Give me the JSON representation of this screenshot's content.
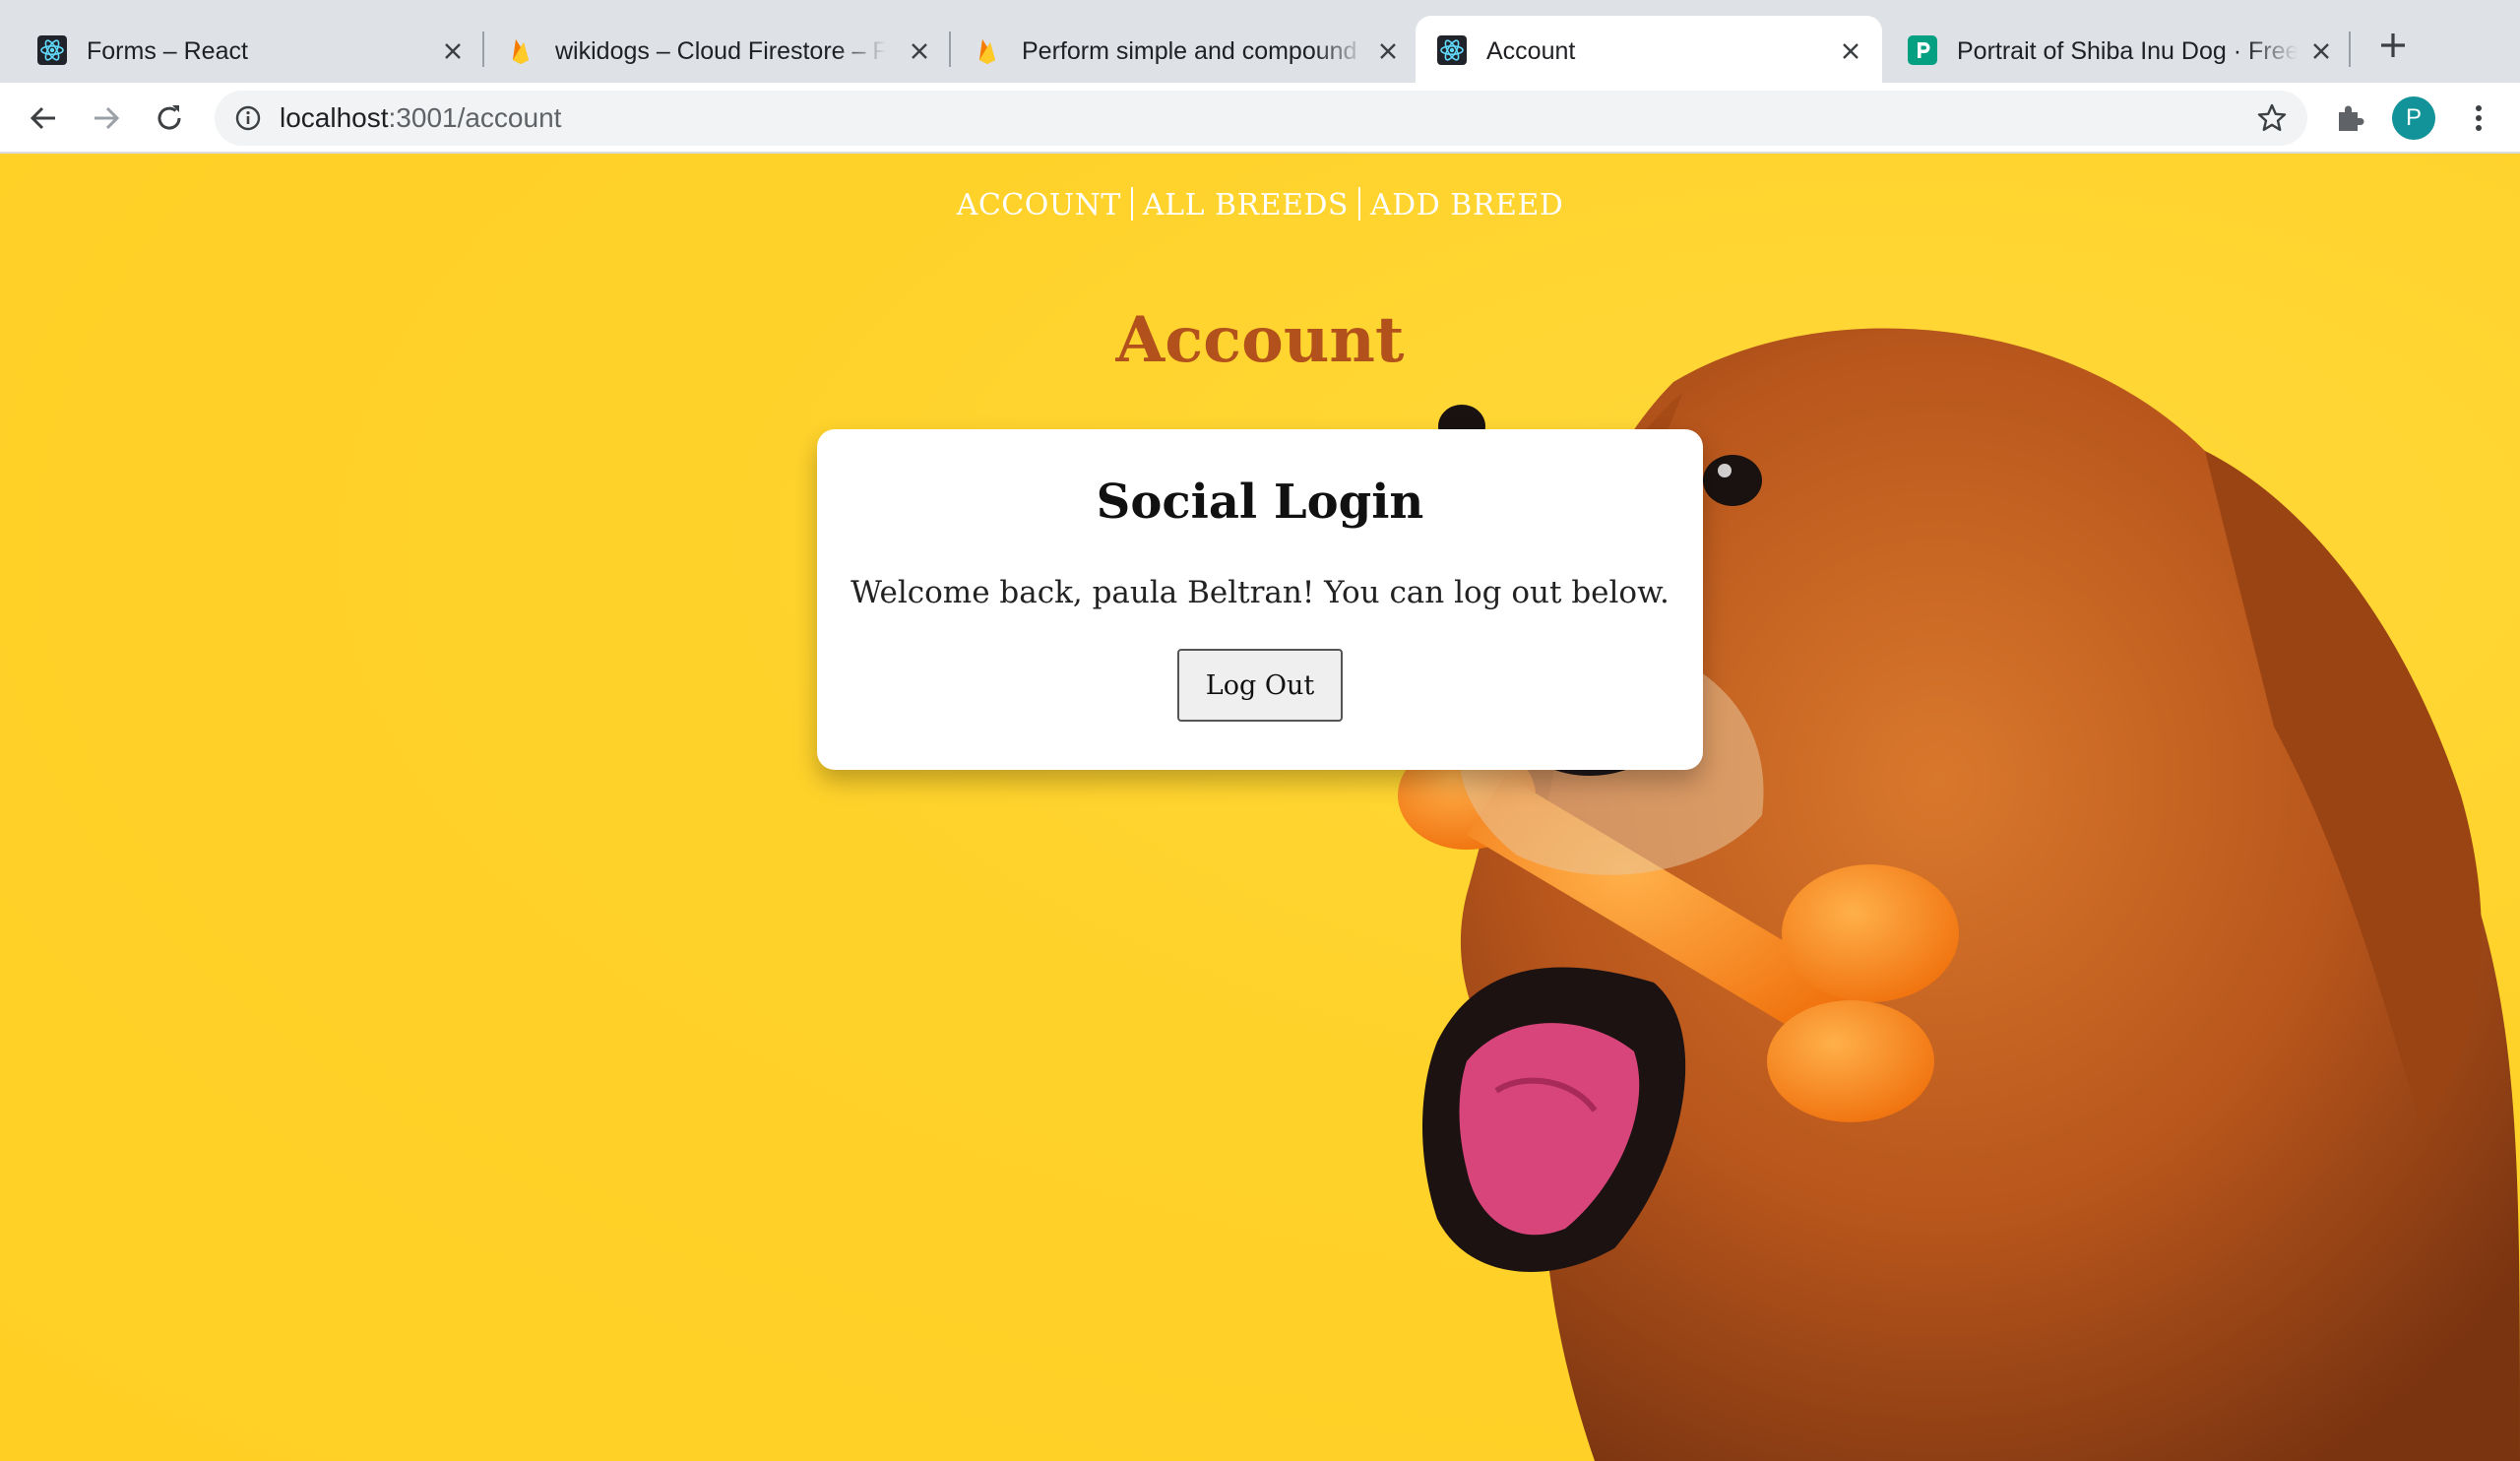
{
  "browser": {
    "tabs": [
      {
        "title": "Forms – React",
        "icon": "react-icon"
      },
      {
        "title": "wikidogs – Cloud Firestore – Fi",
        "icon": "firebase-icon"
      },
      {
        "title": "Perform simple and compound",
        "icon": "firebase-icon"
      },
      {
        "title": "Account",
        "icon": "react-icon",
        "active": true
      },
      {
        "title": "Portrait of Shiba Inu Dog · Free",
        "icon": "pexels-icon"
      }
    ],
    "url_host": "localhost",
    "url_path": ":3001/account",
    "avatar_letter": "P"
  },
  "nav": {
    "items": [
      "ACCOUNT",
      "ALL BREEDS",
      "ADD BREED"
    ]
  },
  "page": {
    "heading": "Account",
    "card": {
      "title": "Social Login",
      "message": "Welcome back, paula Beltran! You can log out below.",
      "logout_label": "Log Out"
    }
  },
  "colors": {
    "background": "#ffd22e",
    "heading": "#b3511c",
    "avatar": "#12939a"
  }
}
